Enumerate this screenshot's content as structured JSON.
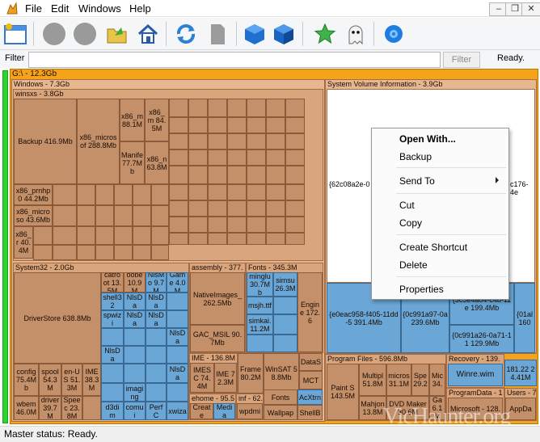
{
  "menu": [
    "File",
    "Edit",
    "Windows",
    "Help"
  ],
  "window_buttons": [
    "–",
    "❐",
    "✕"
  ],
  "toolbar_icons": [
    "app-window-icon",
    "stop-icon",
    "pause-icon",
    "open-folder-icon",
    "home-icon",
    "refresh-icon",
    "document-icon",
    "blue-cube-icon",
    "blue-cube-alt-icon",
    "star-icon",
    "ghost-icon",
    "settings-gear-icon"
  ],
  "filter": {
    "label": "Filter",
    "value": "",
    "button": "Filter",
    "status": "Ready."
  },
  "status": "Master status: Ready.",
  "watermark": "VicHaunter.org",
  "colors": {
    "drive_frame": "#f5a31a",
    "folder": "#c4906a",
    "folder_alt": "#6aa7d6",
    "progress": "#2fd42f"
  },
  "treemap": {
    "drive": "G:\\ - 12.3Gb",
    "windows": "Windows - 7.3Gb",
    "winsxs": "winsxs - 3.8Gb",
    "system_volume": "System Volume Information - 3.9Gb",
    "system32": "System32 - 2.0Gb",
    "assembly": "assembly - 377.",
    "fonts": "Fonts - 345.3M",
    "ime": "IME - 136.8M",
    "ehome": "ehome - 95.5",
    "inf": "inf - 62.",
    "program_files": "Program Files - 596.8Mb",
    "recovery": "Recovery - 139.",
    "programdata": "ProgramData - 1",
    "users": "Users - 7",
    "tiles": {
      "backup": "Backup 416.9Mb",
      "x86_microsoft": "x86_microsof 288.8Mb",
      "x86_88": "x86_m 88.1M",
      "x86_84": "x86_m 84.5M",
      "manife": "Manife 77.7Mb",
      "x86_63": "x86_n 63.8M",
      "prnhp": "x86_prnhp0 44.2Mb",
      "micros2": "x86_microso 43.6Mb",
      "x86_40": "x86_r 40.4M",
      "driverstore": "DriverStore 638.8Mb",
      "config": "config 75.4Mb",
      "spool": "spool 54.3M",
      "enus": "en-US 51.3M",
      "ime_s": "IME 38.3M",
      "wbem": "wbem 46.0M",
      "driver": "driver 39.7M",
      "speec": "Speec 23.8M",
      "native": "NativeImages_ 262.5Mb",
      "gac": "GAC_MSIL 90.7Mb",
      "minglu": "minglu 30.7Mb",
      "simsu": "simsu 26.3M",
      "msjh": "msjh.ttf",
      "simkai": "simkai. 11.2M",
      "engine": "Engine 172.6",
      "imesc": "IMESC 74.4M",
      "ime2": "IME 72.3M",
      "frame": "Frame 80.2M",
      "winsat": "WinSAT 58.8Mb",
      "datas": "DataS",
      "mct": "MCT",
      "fonts_t": "Fonts",
      "acxtrn": "AcXtrn",
      "wallpap": "Wallpap",
      "shellb": "ShellB",
      "svi1": "{e0eac958-f405-11dd-5 391.4Mb",
      "svi2": "{0c991a97-0a 239.6Mb",
      "svi3": "{3c5e4a04-c4b-11e 199.4Mb",
      "svi4": "{0c991a26-0a71-11 129.9Mb",
      "svi5": "{01al 160",
      "svi_main": "{62c08a2e-0",
      "svi_main2": "c176-4e",
      "paint": "Paint S 143.5M",
      "multipl": "Multipl 51.8M",
      "micros_pf": "micros 31.1M",
      "spe": "Spe 29.2",
      "mic": "Mic 34.",
      "mahjon": "Mahjon 13.8M",
      "dvd": "DVD Maker 30.6M",
      "ga": "Ga 6.1M",
      "winre": "Winre.wim",
      "m181": "181.22 24.41M",
      "microsoft_pd": "Microsoft - 128.",
      "appda": "AppDa",
      "catroot": "catroot 13.5M",
      "oobe": "oobe 10.9M",
      "nlsmo": "NlsMo 9.7M",
      "game": "Game 4.0M",
      "shell32": "shell32",
      "nlsda": "NlsDa",
      "spwizi": "spwizi",
      "imaging": "imaging",
      "d3dim": "d3dim",
      "comui": "comui",
      "perfc": "PerfC",
      "xwiza": "xwiza",
      "creat": "Create",
      "media": "Media",
      "wpdmi": "wpdmi"
    }
  },
  "context_menu": {
    "open_with": "Open With...",
    "backup": "Backup",
    "send_to": "Send To",
    "cut": "Cut",
    "copy": "Copy",
    "create_shortcut": "Create Shortcut",
    "delete": "Delete",
    "properties": "Properties"
  }
}
